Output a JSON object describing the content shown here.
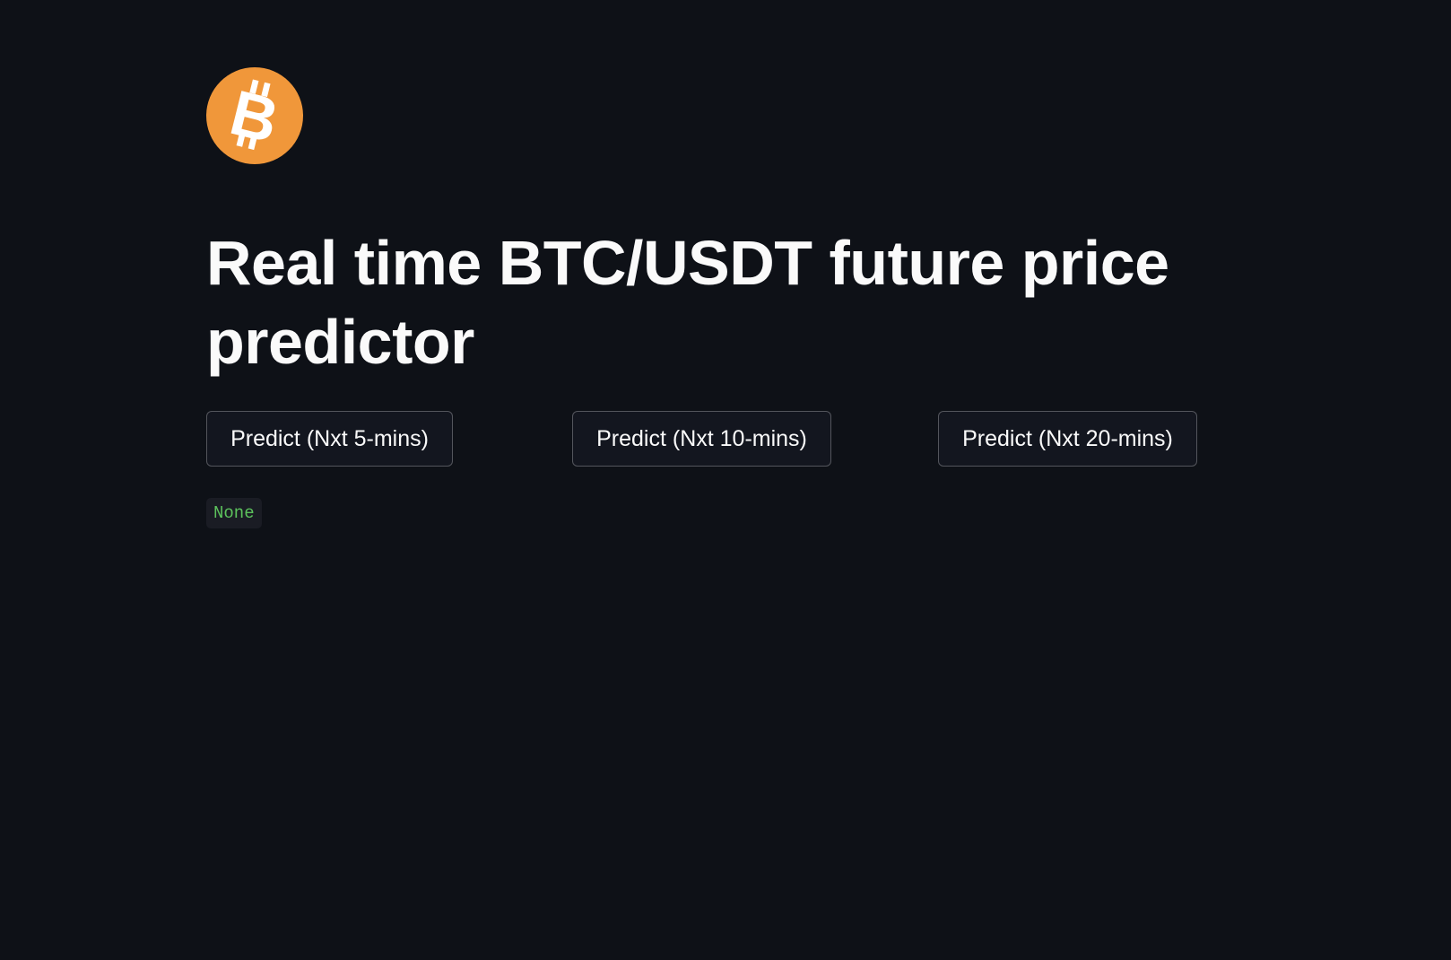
{
  "header": {
    "logo_icon": "bitcoin-icon",
    "logo_color": "#f0973a",
    "title": "Real time BTC/USDT future price predictor"
  },
  "buttons": [
    {
      "label": "Predict (Nxt 5-mins)"
    },
    {
      "label": "Predict (Nxt 10-mins)"
    },
    {
      "label": "Predict (Nxt 20-mins)"
    }
  ],
  "output": {
    "value": "None",
    "color": "#5cc25c"
  },
  "theme": {
    "background": "#0e1117",
    "text": "#fafafa"
  }
}
